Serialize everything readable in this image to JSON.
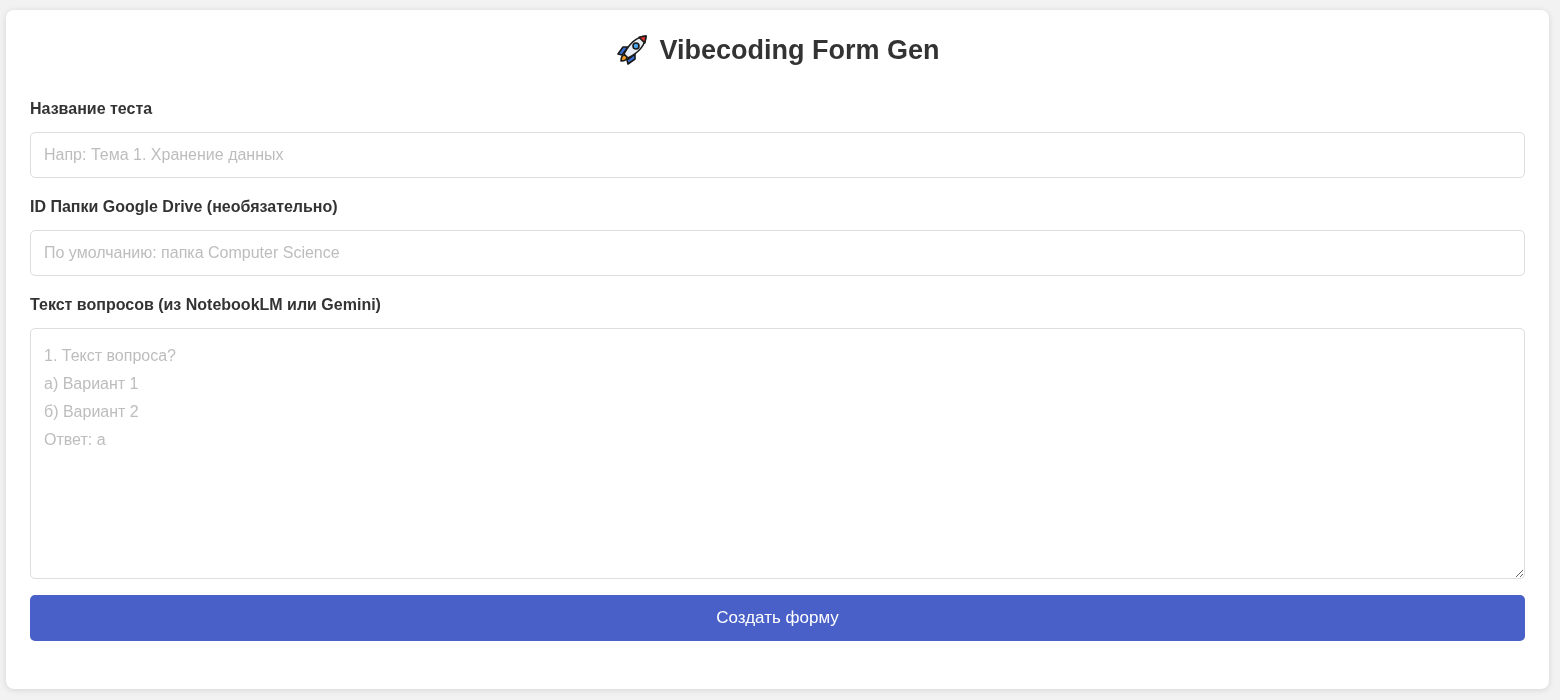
{
  "title": "Vibecoding Form Gen",
  "fields": [
    {
      "kind": "text",
      "label": "Название теста",
      "placeholder": "Напр: Тема 1. Хранение данных"
    },
    {
      "kind": "text",
      "label": "ID Папки Google Drive (необязательно)",
      "placeholder": "По умолчанию: папка Computer Science"
    },
    {
      "kind": "textarea",
      "label": "Текст вопросов (из NotebookLM или Gemini)",
      "placeholder": "1. Текст вопроса?\nа) Вариант 1\nб) Вариант 2\nОтвет: а"
    }
  ],
  "submit_button": {
    "label": "Создать форму"
  }
}
